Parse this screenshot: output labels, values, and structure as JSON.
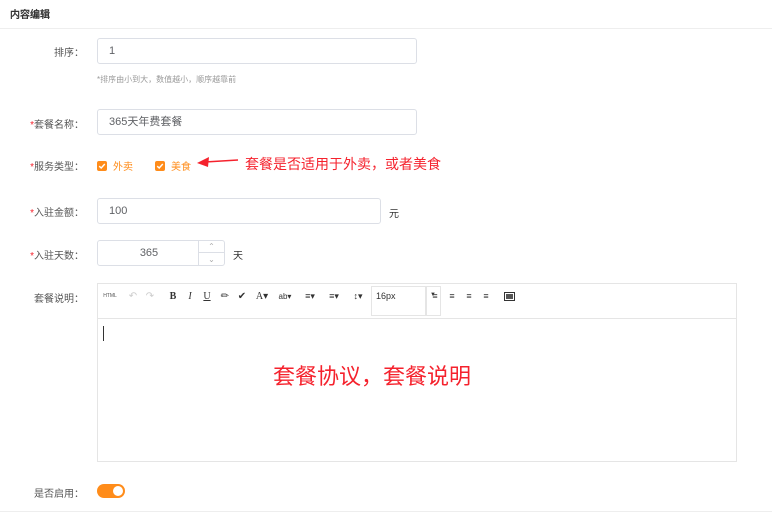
{
  "section": {
    "title": "内容编辑"
  },
  "fields": {
    "sort": {
      "label": "排序：",
      "value": "1",
      "hint": "*排序由小到大，数值越小，顺序越靠前"
    },
    "name": {
      "required": "*",
      "label": "套餐名称：",
      "value": "365天年费套餐"
    },
    "service_type": {
      "required": "*",
      "label": "服务类型：",
      "options": [
        {
          "label": "外卖",
          "checked": true
        },
        {
          "label": "美食",
          "checked": true
        }
      ]
    },
    "fee": {
      "required": "*",
      "label": "入驻金额：",
      "value": "100",
      "unit": "元"
    },
    "days": {
      "required": "*",
      "label": "入驻天数：",
      "value": "365",
      "unit": "天"
    },
    "description": {
      "label": "套餐说明：",
      "toolbar": {
        "html": "HTML",
        "undo": "↶",
        "redo": "↷",
        "bold": "B",
        "italic": "I",
        "underline": "U",
        "font_size": "16px"
      }
    },
    "enabled": {
      "label": "是否启用：",
      "on": true
    }
  },
  "annotations": {
    "service_note": "套餐是否适用于外卖，或者美食",
    "editor_note": "套餐协议，套餐说明"
  },
  "colors": {
    "accent": "#ff8c1a",
    "required": "#f5222d",
    "annotation": "#f5222d"
  }
}
